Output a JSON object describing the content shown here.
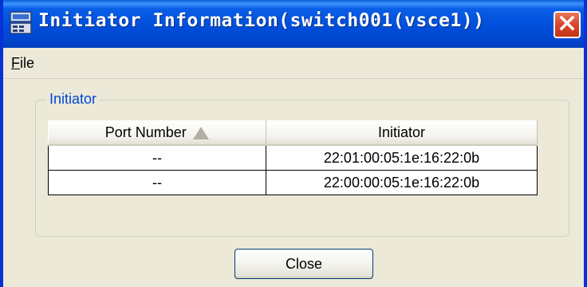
{
  "window": {
    "title": "Initiator Information(switch001(vsce1))",
    "close_icon": "close-x-icon",
    "app_icon": "computer-network-icon"
  },
  "menu": {
    "file_accel": "F",
    "file_rest": "ile"
  },
  "group": {
    "label": "Initiator"
  },
  "table": {
    "columns": [
      "Port Number",
      "Initiator"
    ],
    "sort_indicator": "ascending",
    "rows": [
      {
        "port": "--",
        "initiator": "22:01:00:05:1e:16:22:0b"
      },
      {
        "port": "--",
        "initiator": "22:00:00:05:1e:16:22:0b"
      }
    ]
  },
  "buttons": {
    "close_label": "Close"
  },
  "colors": {
    "titlebar": "#0050DC",
    "window_bg": "#ECE9D8",
    "group_label": "#0046D5",
    "close_button": "#D8462A"
  }
}
